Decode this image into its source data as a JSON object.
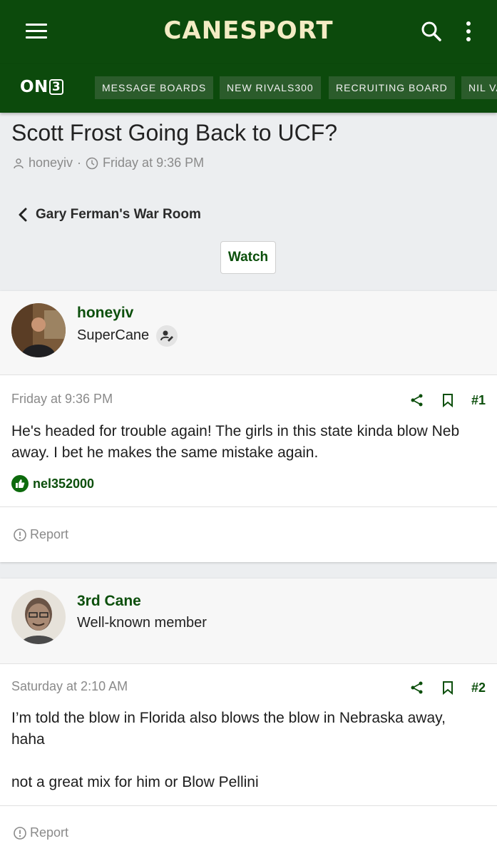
{
  "header": {
    "brand": "CANESPORT",
    "menu_icon": "hamburger-menu-icon",
    "search_icon": "search-icon",
    "more_icon": "more-vertical-icon",
    "background_color": "#0c4a0c"
  },
  "nav": {
    "logo_text": "ON",
    "logo_box": "3",
    "items": [
      {
        "label": "MESSAGE BOARDS"
      },
      {
        "label": "NEW RIVALS300"
      },
      {
        "label": "RECRUITING BOARD"
      },
      {
        "label": "NIL VA"
      }
    ]
  },
  "thread": {
    "title": "Scott Frost Going Back to UCF?",
    "author": "honeyiv",
    "separator": "·",
    "date": "Friday at 9:36 PM",
    "forum": "Gary Ferman's War Room",
    "watch_label": "Watch"
  },
  "posts": [
    {
      "username": "honeyiv",
      "user_title": "SuperCane",
      "date": "Friday at 9:36 PM",
      "number": "#1",
      "text": "He's headed for trouble again! The girls in this state kinda blow Neb away. I bet he makes the same mistake again.",
      "reaction_user": "nel352000",
      "report_label": "Report"
    },
    {
      "username": "3rd Cane",
      "user_title": "Well-known member",
      "date": "Saturday at 2:10 AM",
      "number": "#2",
      "text_lines": [
        "I’m told the blow in Florida also blows the blow in Nebraska away,",
        "haha",
        "",
        "not a great mix for him or Blow Pellini"
      ],
      "report_label": "Report"
    }
  ],
  "colors": {
    "accent_green": "#0c4f0c",
    "brand_text": "#f3ecc4"
  }
}
